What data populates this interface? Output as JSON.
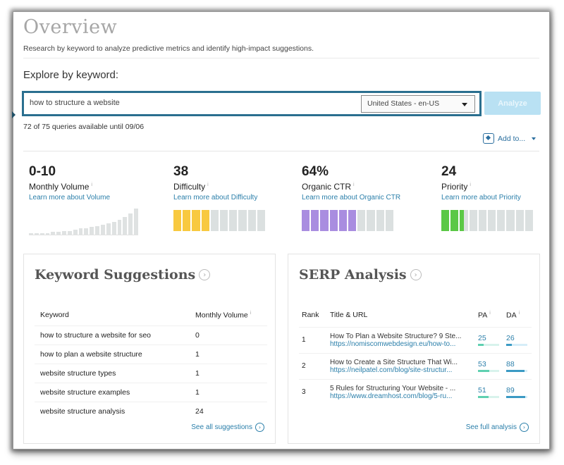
{
  "header": {
    "title": "Overview",
    "subtitle": "Research by keyword to analyze predictive metrics and identify high-impact suggestions."
  },
  "search": {
    "label": "Explore by keyword:",
    "value": "how to structure a website",
    "locale": "United States - en-US",
    "analyze_label": "Analyze",
    "queries_note": "72 of 75 queries available until 09/06",
    "add_to_label": "Add to..."
  },
  "metrics": [
    {
      "value": "0-10",
      "label": "Monthly Volume",
      "info": "i",
      "link": "Learn more about Volume",
      "trend": [
        1,
        1,
        1,
        1,
        2,
        2,
        3,
        3,
        4,
        5,
        5,
        6,
        7,
        8,
        9,
        10,
        12,
        14,
        17,
        21
      ]
    },
    {
      "value": "38",
      "label": "Difficulty",
      "info": "i",
      "link": "Learn more about Difficulty",
      "filled_segments": 4,
      "total_segments": 10,
      "color": "#f8c940"
    },
    {
      "value": "64%",
      "label": "Organic CTR",
      "info": "i",
      "link": "Learn more about Organic CTR",
      "filled_segments": 6,
      "total_segments": 10,
      "color": "#a98de0"
    },
    {
      "value": "24",
      "label": "Priority",
      "info": "i",
      "link": "Learn more about Priority",
      "filled_segments": 2.5,
      "total_segments": 10,
      "color": "#5bc846"
    }
  ],
  "keyword_suggestions": {
    "title": "Keyword Suggestions",
    "columns": [
      "Keyword",
      "Monthly Volume"
    ],
    "info": "i",
    "rows": [
      {
        "keyword": "how to structure a website for seo",
        "volume": "0"
      },
      {
        "keyword": "how to plan a website structure",
        "volume": "1"
      },
      {
        "keyword": "website structure types",
        "volume": "1"
      },
      {
        "keyword": "website structure examples",
        "volume": "1"
      },
      {
        "keyword": "website structure analysis",
        "volume": "24"
      }
    ],
    "see_all_label": "See all suggestions"
  },
  "serp_analysis": {
    "title": "SERP Analysis",
    "columns": [
      "Rank",
      "Title & URL",
      "PA",
      "DA"
    ],
    "info": "i",
    "rows": [
      {
        "rank": "1",
        "title": "How To Plan a Website Structure? 9 Ste...",
        "url": "https://nomiscomwebdesign.eu/how-to...",
        "pa": 25,
        "da": 26
      },
      {
        "rank": "2",
        "title": "How to Create a Site Structure That Wi...",
        "url": "https://neilpatel.com/blog/site-structur...",
        "pa": 53,
        "da": 88
      },
      {
        "rank": "3",
        "title": "5 Rules for Structuring Your Website - ...",
        "url": "https://www.dreamhost.com/blog/5-ru...",
        "pa": 51,
        "da": 89
      }
    ],
    "see_all_label": "See full analysis"
  },
  "colors": {
    "accent": "#2b7faa",
    "search_border": "#2a6f8f",
    "analyze_bg": "#b9e1f3",
    "pa_bar": "#5fd0b0",
    "da_bar": "#3b9ac4",
    "empty_segment": "#dbe0e0"
  }
}
